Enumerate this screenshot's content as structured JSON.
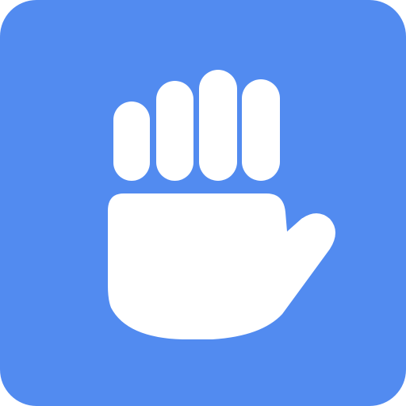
{
  "icon": {
    "name": "raised-hand-icon",
    "colors": {
      "tile": "#528BF0",
      "glyph": "#FFFFFF"
    }
  }
}
